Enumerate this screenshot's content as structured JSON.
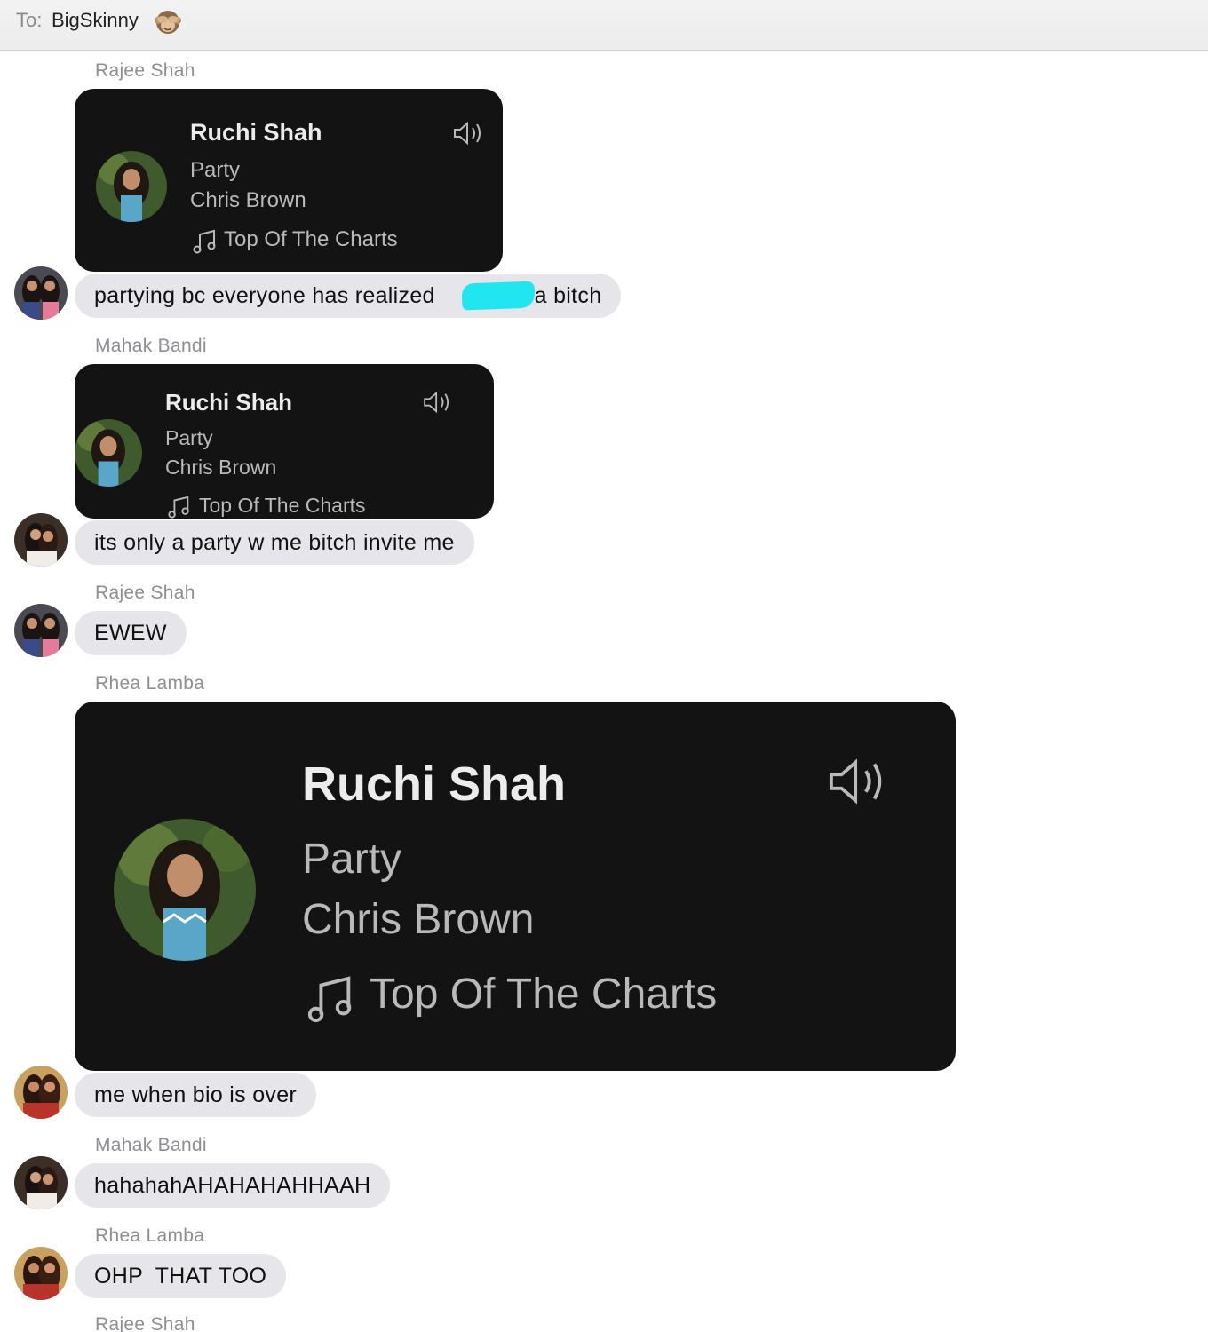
{
  "header": {
    "to_label": "To:",
    "recipient": "BigSkinny",
    "emoji_icon": "see-no-evil-monkey-icon"
  },
  "card": {
    "name": "Ruchi Shah",
    "song": "Party",
    "artist": "Chris Brown",
    "playlist": "Top Of The Charts"
  },
  "messages": [
    {
      "sender": "Rajee Shah",
      "text": "partying bc everyone has realized",
      "text_after": "is a bitch"
    },
    {
      "sender": "Mahak Bandi",
      "text": "its only a party w me bitch invite me"
    },
    {
      "sender": "Rajee Shah",
      "text": "EWEW"
    },
    {
      "sender": "Rhea Lamba",
      "text": "me when bio is over"
    },
    {
      "sender": "Mahak Bandi",
      "text": "hahahahAHAHAHAHHAAH"
    },
    {
      "sender": "Rhea Lamba",
      "text": "OHP  THAT TOO"
    },
    {
      "sender": "Rajee Shah"
    }
  ],
  "colors": {
    "bubble_bg": "#e5e5ea",
    "card_bg": "#131313",
    "redaction": "#21e6f0"
  }
}
